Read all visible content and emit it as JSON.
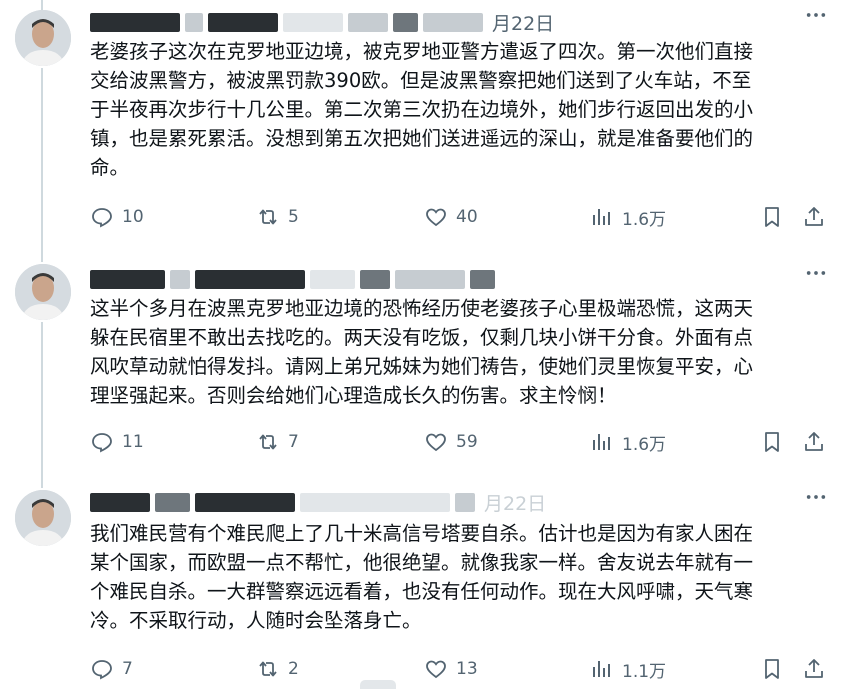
{
  "tweets": [
    {
      "date": "月22日",
      "text": "老婆孩子这次在克罗地亚边境，被克罗地亚警方遣返了四次。第一次他们直接\n交给波黑警方，被波黑罚款390欧。但是波黑警察把她们送到了火车站，不至\n于半夜再次步行十几公里。第二次第三次扔在边境外，她们步行返回出发的小\n镇，也是累死累活。没想到第五次把她们送进遥远的深山，就是准备要他们的\n命。",
      "replies": "10",
      "retweets": "5",
      "likes": "40",
      "views": "1.6万"
    },
    {
      "date": "",
      "text": "这半个多月在波黑克罗地亚边境的恐怖经历使老婆孩子心里极端恐慌，这两天\n躲在民宿里不敢出去找吃的。两天没有吃饭，仅剩几块小饼干分食。外面有点\n风吹草动就怕得发抖。请网上弟兄姊妹为她们祷告，使她们灵里恢复平安，心\n理坚强起来。否则会给她们心理造成长久的伤害。求主怜悯！",
      "replies": "11",
      "retweets": "7",
      "likes": "59",
      "views": "1.6万"
    },
    {
      "date": "月22日",
      "text": "我们难民营有个难民爬上了几十米高信号塔要自杀。估计也是因为有家人困在\n某个国家，而欧盟一点不帮忙，他很绝望。就像我家一样。舍友说去年就有一\n个难民自杀。一大群警察远远看着，也没有任何动作。现在大风呼啸，天气寒\n冷。不采取行动，人随时会坠落身亡。",
      "replies": "7",
      "retweets": "2",
      "likes": "13",
      "views": "1.1万"
    }
  ],
  "icons": {
    "more": "more-icon",
    "reply": "reply-icon",
    "retweet": "retweet-icon",
    "like": "like-icon",
    "views": "views-icon",
    "bookmark": "bookmark-icon",
    "share": "share-icon"
  },
  "colors": {
    "text": "#0f1419",
    "muted": "#536471",
    "thread": "#cfd9de"
  }
}
